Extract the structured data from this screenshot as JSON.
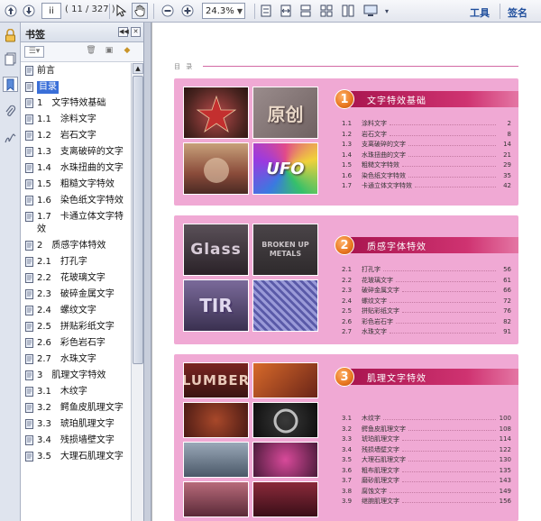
{
  "toolbar": {
    "page_current": "ii",
    "page_count": "( 11 / 327 )",
    "zoom": "24.3%",
    "tools_label": "工具",
    "sign_label": "签名"
  },
  "panel": {
    "title": "书签"
  },
  "bookmarks": [
    {
      "label": "前言",
      "selected": false
    },
    {
      "label": "目录",
      "selected": true
    },
    {
      "label": "1　文字特效基础",
      "selected": false
    },
    {
      "label": "1.1　涂料文字",
      "selected": false
    },
    {
      "label": "1.2　岩石文字",
      "selected": false
    },
    {
      "label": "1.3　支离破碎的文字",
      "selected": false
    },
    {
      "label": "1.4　水珠扭曲的文字",
      "selected": false
    },
    {
      "label": "1.5　粗糙文字特效",
      "selected": false
    },
    {
      "label": "1.6　染色纸文字特效",
      "selected": false
    },
    {
      "label": "1.7　卡通立体文字特效",
      "selected": false
    },
    {
      "label": "2　质感字体特效",
      "selected": false
    },
    {
      "label": "2.1　打孔字",
      "selected": false
    },
    {
      "label": "2.2　花玻璃文字",
      "selected": false
    },
    {
      "label": "2.3　破碎金属文字",
      "selected": false
    },
    {
      "label": "2.4　螺纹文字",
      "selected": false
    },
    {
      "label": "2.5　拼贴彩纸文字",
      "selected": false
    },
    {
      "label": "2.6　彩色岩石字",
      "selected": false
    },
    {
      "label": "2.7　水珠文字",
      "selected": false
    },
    {
      "label": "3　肌理文字特效",
      "selected": false
    },
    {
      "label": "3.1　木纹字",
      "selected": false
    },
    {
      "label": "3.2　鳄鱼皮肌理文字",
      "selected": false
    },
    {
      "label": "3.3　琥珀肌理文字",
      "selected": false
    },
    {
      "label": "3.4　残损墙壁文字",
      "selected": false
    },
    {
      "label": "3.5　大理石肌理文字",
      "selected": false
    }
  ],
  "document": {
    "page_label": "目 录",
    "chapters": [
      {
        "number": "1",
        "title": "文字特效基础",
        "thumb_text": [
          "",
          "原创",
          "",
          "UFO"
        ],
        "entries": [
          {
            "num": "1.1",
            "title": "涂料文字",
            "page": "2"
          },
          {
            "num": "1.2",
            "title": "岩石文字",
            "page": "8"
          },
          {
            "num": "1.3",
            "title": "支离破碎的文字",
            "page": "14"
          },
          {
            "num": "1.4",
            "title": "水珠扭曲的文字",
            "page": "21"
          },
          {
            "num": "1.5",
            "title": "粗糙文字特效",
            "page": "29"
          },
          {
            "num": "1.6",
            "title": "染色纸文字特效",
            "page": "35"
          },
          {
            "num": "1.7",
            "title": "卡通立体文字特效",
            "page": "42"
          }
        ]
      },
      {
        "number": "2",
        "title": "质感字体特效",
        "thumb_text": [
          "Glass",
          "BROKEN UP METALS",
          "TIR",
          ""
        ],
        "entries": [
          {
            "num": "2.1",
            "title": "打孔字",
            "page": "56"
          },
          {
            "num": "2.2",
            "title": "花玻璃文字",
            "page": "61"
          },
          {
            "num": "2.3",
            "title": "破碎金属文字",
            "page": "66"
          },
          {
            "num": "2.4",
            "title": "螺纹文字",
            "page": "72"
          },
          {
            "num": "2.5",
            "title": "拼贴彩纸文字",
            "page": "76"
          },
          {
            "num": "2.6",
            "title": "彩色岩石字",
            "page": "82"
          },
          {
            "num": "2.7",
            "title": "水珠文字",
            "page": "91"
          }
        ]
      },
      {
        "number": "3",
        "title": "肌理文字特效",
        "thumb_text": [
          "LUMBER",
          "",
          "",
          ""
        ],
        "entries": [
          {
            "num": "3.1",
            "title": "木纹字",
            "page": "100"
          },
          {
            "num": "3.2",
            "title": "鳄鱼皮肌理文字",
            "page": "108"
          },
          {
            "num": "3.3",
            "title": "琥珀肌理文字",
            "page": "114"
          },
          {
            "num": "3.4",
            "title": "残损墙壁文字",
            "page": "122"
          },
          {
            "num": "3.5",
            "title": "大理石肌理文字",
            "page": "130"
          },
          {
            "num": "3.6",
            "title": "粗布肌理文字",
            "page": "135"
          },
          {
            "num": "3.7",
            "title": "磨砂肌理文字",
            "page": "143"
          },
          {
            "num": "3.8",
            "title": "腐蚀文字",
            "page": "149"
          },
          {
            "num": "3.9",
            "title": "继腕肌理文字",
            "page": "156"
          }
        ]
      }
    ]
  },
  "icons": {
    "rail": [
      "lock-icon",
      "pages-icon",
      "bookmark-icon",
      "attachment-icon",
      "signature-icon"
    ],
    "toolbar": [
      "up-arrow-icon",
      "down-arrow-icon",
      "select-cursor-icon",
      "hand-icon",
      "zoom-out-icon",
      "zoom-in-icon",
      "fit-page-icon",
      "fit-width-icon",
      "single-page-icon",
      "two-page-icon",
      "scroll-icon",
      "display-icon"
    ]
  },
  "colors": {
    "chapter_bg": "#f0a9d4",
    "chapter_bar": "#a9154f",
    "accent_circle": "#e8761f",
    "selection": "#3a6fd8"
  }
}
